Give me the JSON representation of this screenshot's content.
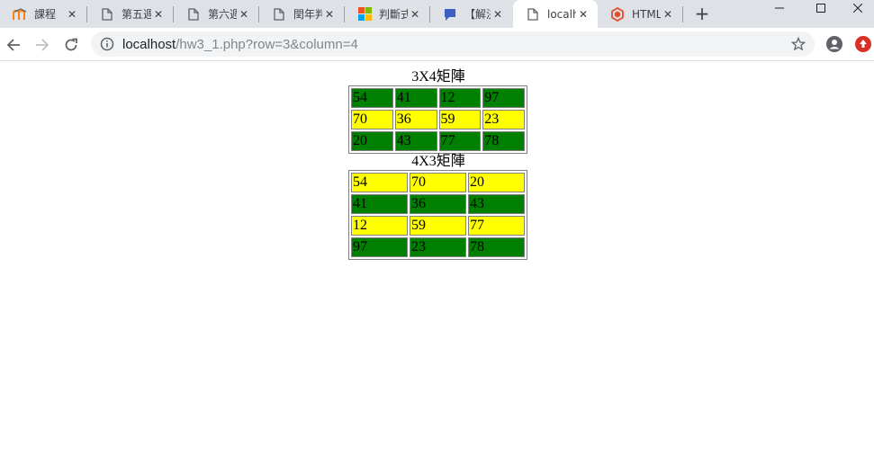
{
  "browser": {
    "tabs": [
      {
        "title": "課程",
        "icon": "moodle-icon",
        "active": false
      },
      {
        "title": "第五週",
        "icon": "page-icon",
        "active": false
      },
      {
        "title": "第六週",
        "icon": "page-icon",
        "active": false
      },
      {
        "title": "閏年判",
        "icon": "page-icon",
        "active": false
      },
      {
        "title": "判斷式",
        "icon": "microsoft-icon",
        "active": false
      },
      {
        "title": "【解決",
        "icon": "chat-bubble-icon",
        "active": false
      },
      {
        "title": "localh",
        "icon": "page-icon",
        "active": true
      },
      {
        "title": "HTML",
        "icon": "html5-icon",
        "active": false
      }
    ],
    "new_tab_label": "+",
    "address": {
      "host": "localhost",
      "path": "/hw3_1.php?row=3&column=4"
    }
  },
  "page": {
    "matrix1": {
      "caption": "3X4矩陣",
      "rows": [
        {
          "color": "green",
          "cells": [
            "54",
            "41",
            "12",
            "97"
          ]
        },
        {
          "color": "yellow",
          "cells": [
            "70",
            "36",
            "59",
            "23"
          ]
        },
        {
          "color": "green",
          "cells": [
            "20",
            "43",
            "77",
            "78"
          ]
        }
      ]
    },
    "matrix2": {
      "caption": "4X3矩陣",
      "rows": [
        {
          "color": "yellow",
          "cells": [
            "54",
            "70",
            "20"
          ]
        },
        {
          "color": "green",
          "cells": [
            "41",
            "36",
            "43"
          ]
        },
        {
          "color": "yellow",
          "cells": [
            "12",
            "59",
            "77"
          ]
        },
        {
          "color": "green",
          "cells": [
            "97",
            "23",
            "78"
          ]
        }
      ]
    }
  },
  "colors": {
    "green": "#008000",
    "yellow": "#ffff00",
    "tabstrip": "#dee1e6"
  }
}
